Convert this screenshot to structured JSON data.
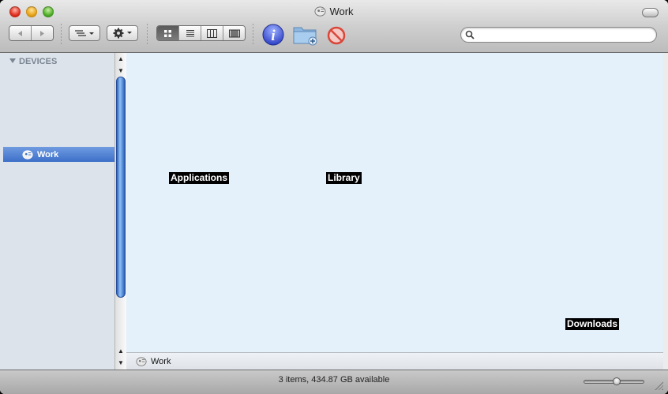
{
  "window": {
    "title": "Work",
    "title_icon": "hard-drive-icon"
  },
  "toolbar": {
    "back_icon": "back-arrow-icon",
    "forward_icon": "forward-arrow-icon",
    "arrange_icon": "arrange-menu-icon",
    "action_icon": "gear-icon",
    "view_modes": [
      "icon-view",
      "list-view",
      "column-view",
      "coverflow-view"
    ],
    "active_view": "icon-view",
    "info_icon": "info-icon",
    "new_folder_icon": "new-folder-icon",
    "delete_icon": "delete-icon",
    "search": {
      "placeholder": "",
      "value": ""
    }
  },
  "sidebar": {
    "section_title": "DEVICES",
    "items": [
      {
        "label": "Work",
        "icon": "hard-drive-icon",
        "selected": true
      }
    ]
  },
  "content": {
    "files": [
      {
        "name": "Applications"
      },
      {
        "name": "Library"
      },
      {
        "name": "Downloads"
      }
    ]
  },
  "pathbar": {
    "label": "Work",
    "icon": "hard-drive-icon"
  },
  "status": {
    "text": "3 items, 434.87 GB available",
    "zoom_level": 0.55
  },
  "colors": {
    "content_bg": "#e4f1fa",
    "sidebar_bg": "#dde3ea",
    "selection": "#3c6fc8",
    "label_bg": "#000000",
    "label_text": "#ffffff"
  }
}
